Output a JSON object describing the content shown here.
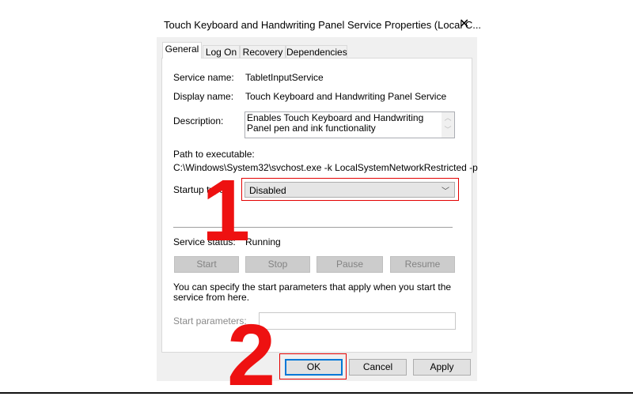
{
  "window": {
    "title": "Touch Keyboard and Handwriting Panel Service Properties (Local C...",
    "close_icon": "close-icon"
  },
  "tabs": [
    {
      "label": "General",
      "selected": true
    },
    {
      "label": "Log On"
    },
    {
      "label": "Recovery"
    },
    {
      "label": "Dependencies"
    }
  ],
  "general": {
    "service_name_label": "Service name:",
    "service_name": "TabletInputService",
    "display_name_label": "Display name:",
    "display_name": "Touch Keyboard and Handwriting Panel Service",
    "description_label": "Description:",
    "description": "Enables Touch Keyboard and Handwriting Panel pen and ink functionality",
    "path_label": "Path to executable:",
    "path": "C:\\Windows\\System32\\svchost.exe -k LocalSystemNetworkRestricted -p",
    "startup_type_label": "Startup type:",
    "startup_type": "Disabled",
    "service_status_label": "Service status:",
    "service_status": "Running",
    "control_buttons": {
      "start": "Start",
      "stop": "Stop",
      "pause": "Pause",
      "resume": "Resume"
    },
    "params_help": "You can specify the start parameters that apply when you start the service from here.",
    "start_parameters_label": "Start parameters:",
    "start_parameters_value": ""
  },
  "footer": {
    "ok": "OK",
    "cancel": "Cancel",
    "apply": "Apply"
  },
  "annotations": {
    "step1": "1",
    "step2": "2",
    "color": "#ee1111"
  }
}
